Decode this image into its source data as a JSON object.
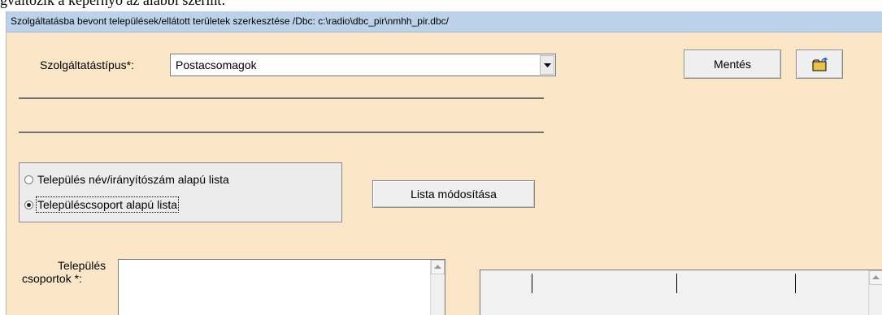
{
  "document": {
    "text_fragment": "gváltozik a képernyő az alábbi szerint:"
  },
  "window": {
    "title": "Szolgáltatásba bevont települések/ellátott területek szerkesztése  /Dbc: c:\\radio\\dbc_pir\\nmhh_pir.dbc/"
  },
  "form": {
    "service_type_label": "Szolgáltatástípus*:",
    "service_type_value": "Postacsomagok",
    "save_label": "Mentés",
    "open_icon": "folder-open-icon",
    "radio_options": [
      {
        "label": "Település név/irányítószám alapú lista",
        "selected": false
      },
      {
        "label": "Településcsoport alapú lista",
        "selected": true
      }
    ],
    "modify_list_label": "Lista módosítása",
    "groups_label_line1": "Település",
    "groups_label_line2": "csoportok *:"
  },
  "colors": {
    "window_background": "#fbe7c8",
    "titlebar_background": "#bcd2ea",
    "button_face": "#efefef",
    "folder_icon": "#e8c24a"
  }
}
